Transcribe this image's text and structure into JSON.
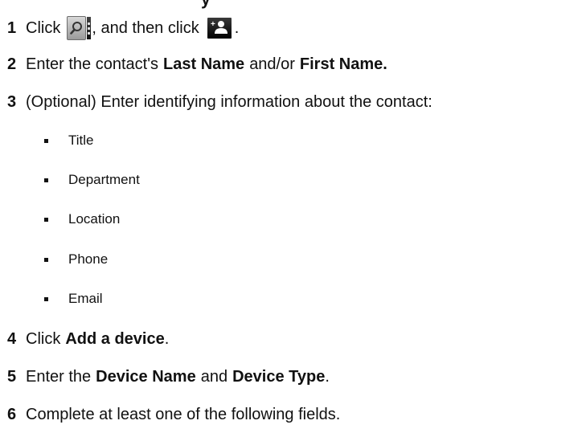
{
  "heading_fragment": "y",
  "steps": [
    {
      "number": "1",
      "click_text": "Click",
      "then_text": ", and then click",
      "period": "."
    },
    {
      "number": "2",
      "pre": "Enter the contact's",
      "bold1": "Last Name",
      "mid": "and/or",
      "bold2": "First Name."
    },
    {
      "number": "3",
      "text": "(Optional) Enter identifying information about the contact:"
    },
    {
      "number": "4",
      "pre": "Click",
      "bold": "Add a device",
      "post": "."
    },
    {
      "number": "5",
      "pre": "Enter the",
      "bold1": "Device Name",
      "mid": "and",
      "bold2": "Device Type",
      "post": "."
    },
    {
      "number": "6",
      "text": "Complete at least one of the following fields."
    }
  ],
  "bullets": [
    "Title",
    "Department",
    "Location",
    "Phone",
    "Email"
  ],
  "icons": {
    "directory": "directory-search-icon",
    "add_contact": "add-contact-icon"
  }
}
